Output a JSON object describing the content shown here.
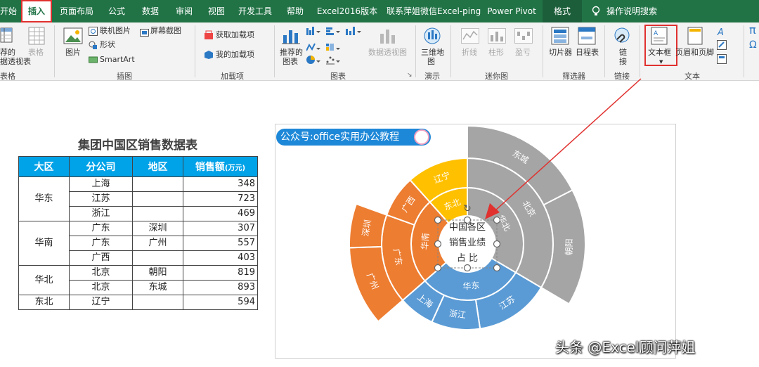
{
  "tabs": {
    "t1": "开始",
    "t2": "插入",
    "t3": "页面布局",
    "t4": "公式",
    "t5": "数据",
    "t6": "审阅",
    "t7": "视图",
    "t8": "开发工具",
    "t9": "帮助",
    "t10": "Excel2016版本",
    "t11": "联系萍姐微信Excel-ping",
    "t12": "Power Pivot",
    "t13": "格式",
    "t14": "操作说明搜索"
  },
  "ribbon": {
    "pivot_l1": "荐的",
    "pivot_l2": "据透视表",
    "pivot_group": "表格",
    "table": "表格",
    "picture": "图片",
    "online_pic": "联机图片",
    "shapes": "形状",
    "smartart": "SmartArt",
    "screenshot": "屏幕截图",
    "illus_group": "插图",
    "get_addin": "获取加载项",
    "my_addin": "我的加载项",
    "addin_group": "加载项",
    "rec_chart_l1": "推荐的",
    "rec_chart_l2": "图表",
    "pivot_chart": "数据透视图",
    "chart_group": "图表",
    "map3d_l1": "三维地",
    "map3d_l2": "图",
    "demo_group": "演示",
    "spark_line": "折线",
    "spark_col": "柱形",
    "spark_wl": "盈亏",
    "spark_group": "迷你图",
    "slicer": "切片器",
    "timeline": "日程表",
    "filter_group": "筛选器",
    "link_l1": "链",
    "link_l2": "接",
    "link_group": "链接",
    "textbox": "文本框",
    "header_footer": "页眉和页脚",
    "text_group": "文本"
  },
  "sheet": {
    "title": "集团中国区销售数据表",
    "headers": {
      "region": "大区",
      "branch": "分公司",
      "area": "地区",
      "sales": "销售额",
      "unit": "(万元)"
    },
    "rows": [
      {
        "region": "华东",
        "branch": "上海",
        "area": "",
        "sales": "348"
      },
      {
        "region": "",
        "branch": "江苏",
        "area": "",
        "sales": "723"
      },
      {
        "region": "",
        "branch": "浙江",
        "area": "",
        "sales": "469"
      },
      {
        "region": "华南",
        "branch": "广东",
        "area": "深圳",
        "sales": "307"
      },
      {
        "region": "",
        "branch": "广东",
        "area": "广州",
        "sales": "557"
      },
      {
        "region": "",
        "branch": "广西",
        "area": "",
        "sales": "403"
      },
      {
        "region": "华北",
        "branch": "北京",
        "area": "朝阳",
        "sales": "819"
      },
      {
        "region": "",
        "branch": "北京",
        "area": "东城",
        "sales": "893"
      },
      {
        "region": "东北",
        "branch": "辽宁",
        "area": "",
        "sales": "594"
      }
    ]
  },
  "chart_data": {
    "type": "sunburst",
    "badge": "公众号:office实用办公教程",
    "center_text": {
      "l1": "中国各区",
      "l2": "销售业绩",
      "l3": "占   比"
    },
    "colors": {
      "华北": "#a5a5a5",
      "东北": "#ffc000",
      "华南": "#ed7d31",
      "华东": "#5b9bd5"
    },
    "hierarchy": [
      {
        "region": "华北",
        "children": [
          {
            "name": "北京",
            "children": [
              {
                "name": "东城",
                "value": 893
              },
              {
                "name": "朝阳",
                "value": 819
              }
            ]
          }
        ]
      },
      {
        "region": "华东",
        "children": [
          {
            "name": "江苏",
            "value": 723
          },
          {
            "name": "浙江",
            "value": 469
          },
          {
            "name": "上海",
            "value": 348
          }
        ]
      },
      {
        "region": "华南",
        "children": [
          {
            "name": "广东",
            "children": [
              {
                "name": "广州",
                "value": 557
              },
              {
                "name": "深圳",
                "value": 307
              }
            ]
          },
          {
            "name": "广西",
            "value": 403
          }
        ]
      },
      {
        "region": "东北",
        "children": [
          {
            "name": "辽宁",
            "value": 594
          }
        ]
      }
    ]
  },
  "watermark": "头条 @Excel顾问萍姐"
}
